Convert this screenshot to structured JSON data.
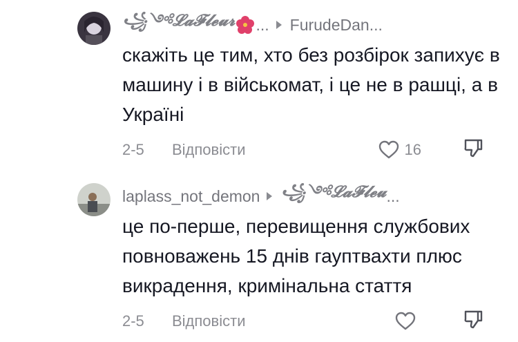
{
  "comments": [
    {
      "header": {
        "username": "꧁༺𝓛𝓪𝓕𝓵𝓮𝓾𝓻",
        "username_tail": "...",
        "reply_to": "FurudeDan..."
      },
      "text": "скажіть це тим, хто без розбірок запихує в машину і в військомат, і це не в рашці, а в Україні",
      "date": "2-5",
      "reply_label": "Відповісти",
      "like_count": "16"
    },
    {
      "header": {
        "username": "laplass_not_demon",
        "reply_to": "꧁༺𝓛𝓪𝓕𝓵𝓮𝓾",
        "reply_to_tail": "..."
      },
      "text": "це по-перше, перевищення службових повноважень 15 днів гауптвахти плюс викрадення, кримінальна стаття",
      "date": "2-5",
      "reply_label": "Відповісти",
      "like_count": ""
    }
  ],
  "colors": {
    "text": "#161823",
    "muted": "rgba(22,24,35,0.5)",
    "flower": "#e0406a"
  },
  "icons": [
    "heart-icon",
    "dislike-icon",
    "reply-arrow-icon",
    "hibiscus-icon"
  ]
}
